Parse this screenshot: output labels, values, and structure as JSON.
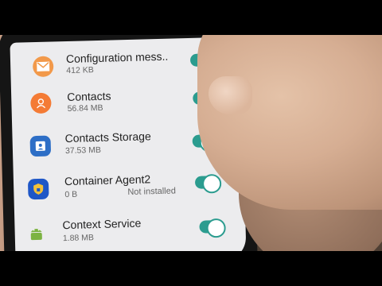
{
  "apps": [
    {
      "title": "Configuration mess..",
      "size": "412 KB",
      "note": "",
      "icon": "envelope-icon",
      "icon_color": "#f2994a",
      "enabled": true
    },
    {
      "title": "Contacts",
      "size": "56.84 MB",
      "note": "",
      "icon": "contact-person-icon",
      "icon_color": "#f47b35",
      "enabled": true
    },
    {
      "title": "Contacts Storage",
      "size": "37.53 MB",
      "note": "",
      "icon": "contact-card-icon",
      "icon_color": "#2d6ec6",
      "enabled": true
    },
    {
      "title": "Container Agent2",
      "size": "0 B",
      "note": "Not installed",
      "icon": "shield-lock-icon",
      "icon_color": "#1f57c7",
      "enabled": true
    },
    {
      "title": "Context Service",
      "size": "1.88 MB",
      "note": "",
      "icon": "android-icon",
      "icon_color": "#7cb342",
      "enabled": true
    }
  ],
  "colors": {
    "toggle_on": "#2b9c8f",
    "screen_bg": "#ececee"
  }
}
